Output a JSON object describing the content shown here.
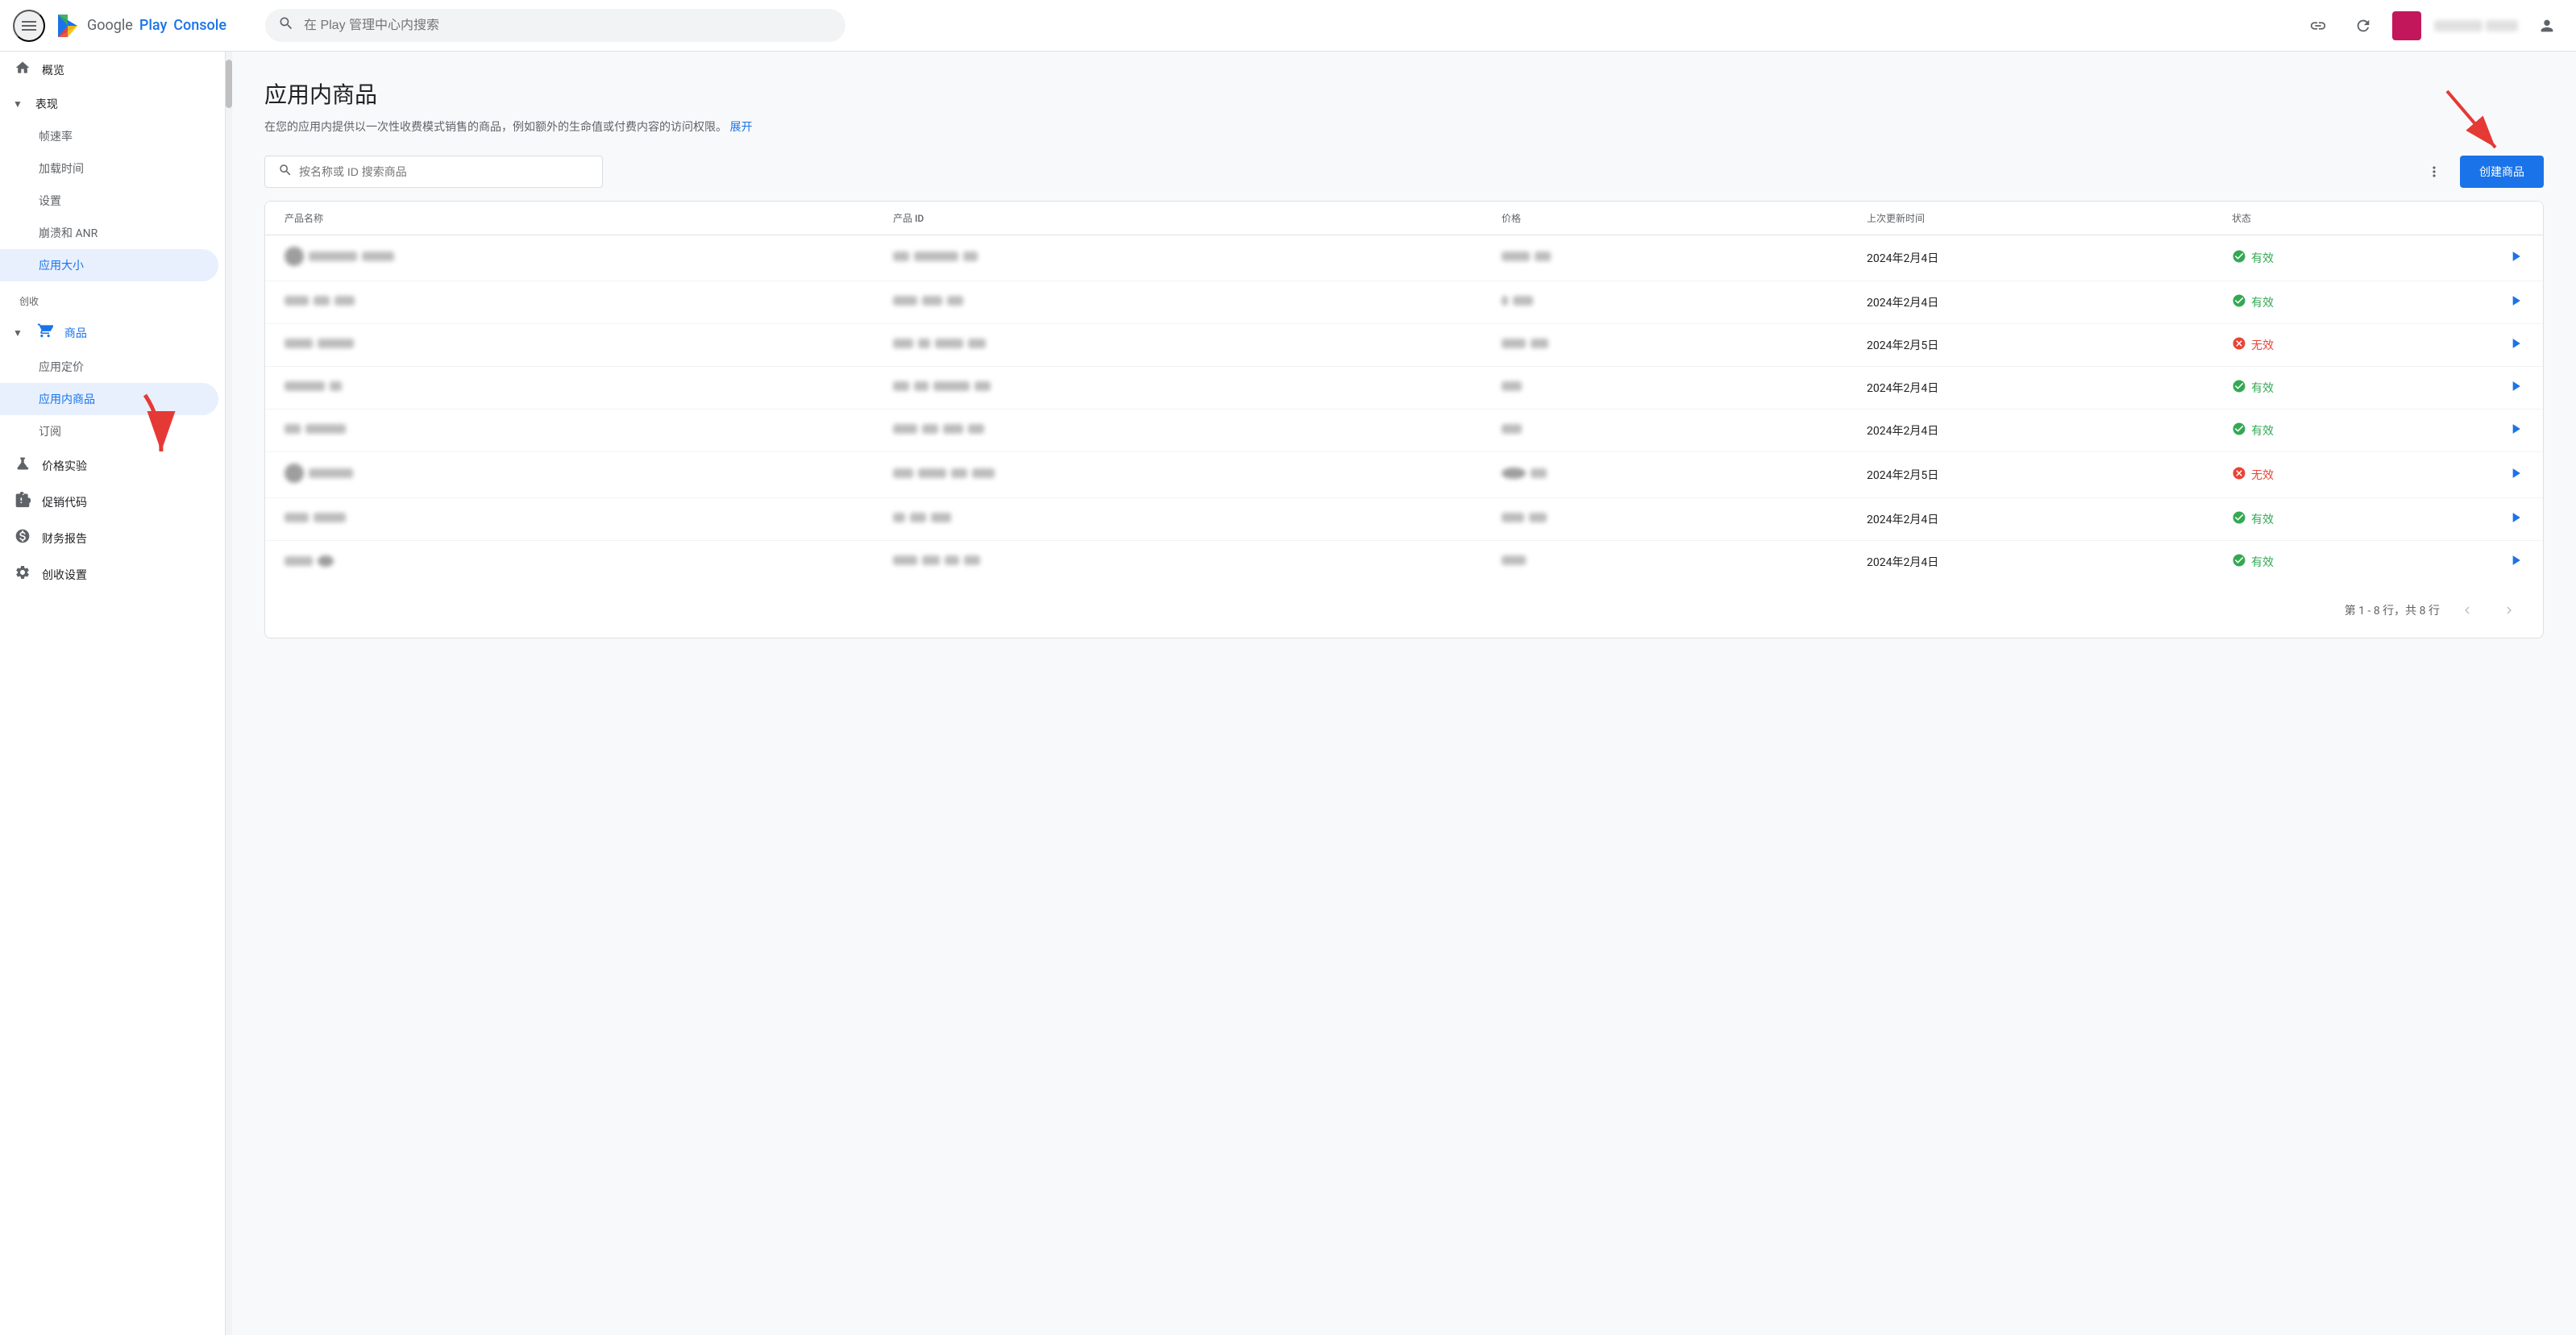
{
  "app": {
    "title": "Google Play Console",
    "logo_text_google": "Google",
    "logo_text_play": "Play",
    "logo_text_console": "Console"
  },
  "topbar": {
    "search_placeholder": "在 Play 管理中心内搜索"
  },
  "sidebar": {
    "overview": "概览",
    "performance_section": "表现",
    "frame_rate": "帧速率",
    "load_time": "加载时间",
    "settings": "设置",
    "crash_anr": "崩溃和 ANR",
    "app_size": "应用大小",
    "monetize_section": "创收",
    "products": "商品",
    "app_pricing": "应用定价",
    "in_app_products": "应用内商品",
    "subscriptions": "订阅",
    "price_experiments": "价格实验",
    "promo_codes": "促销代码",
    "financial_reports": "财务报告",
    "monetize_settings": "创收设置"
  },
  "page": {
    "title": "应用内商品",
    "description": "在您的应用内提供以一次性收费模式销售的商品，例如额外的生命值或付费内容的访问权限。",
    "description_link": "展开",
    "search_placeholder": "按名称或 ID 搜索商品"
  },
  "table": {
    "columns": [
      "产品名称",
      "产品 ID",
      "价格",
      "上次更新时间",
      "状态",
      ""
    ],
    "rows": [
      {
        "name_blur": true,
        "id_blur": true,
        "price_blur": true,
        "date": "2024年2月4日",
        "status": "有效",
        "status_type": "valid"
      },
      {
        "name_blur": true,
        "id_blur": true,
        "price_blur": true,
        "date": "2024年2月4日",
        "status": "有效",
        "status_type": "valid"
      },
      {
        "name_blur": true,
        "id_blur": true,
        "price_blur": true,
        "date": "2024年2月5日",
        "status": "无效",
        "status_type": "invalid"
      },
      {
        "name_blur": true,
        "id_blur": true,
        "price_blur": true,
        "date": "2024年2月4日",
        "status": "有效",
        "status_type": "valid"
      },
      {
        "name_blur": true,
        "id_blur": true,
        "price_blur": true,
        "date": "2024年2月4日",
        "status": "有效",
        "status_type": "valid"
      },
      {
        "name_blur": true,
        "id_blur": true,
        "price_blur": true,
        "date": "2024年2月5日",
        "status": "无效",
        "status_type": "invalid"
      },
      {
        "name_blur": true,
        "id_blur": true,
        "price_blur": true,
        "date": "2024年2月4日",
        "status": "有效",
        "status_type": "valid"
      },
      {
        "name_blur": true,
        "id_blur": true,
        "price_blur": true,
        "date": "2024年2月4日",
        "status": "有效",
        "status_type": "valid"
      }
    ],
    "pagination": "第 1 - 8 行，共 8 行",
    "create_button": "创建商品"
  },
  "colors": {
    "blue": "#1a73e8",
    "green": "#34a853",
    "red": "#ea4335",
    "active_bg": "#e8f0fe"
  }
}
